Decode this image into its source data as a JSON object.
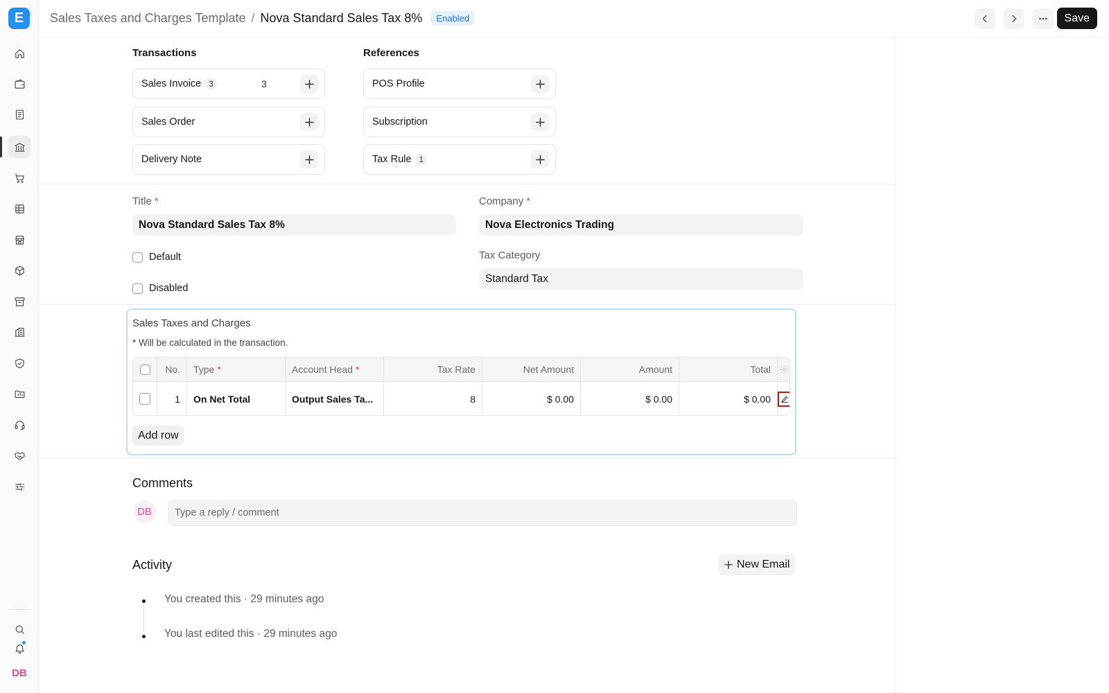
{
  "app": {
    "logo_letter": "E"
  },
  "sidebar": {
    "items": [
      {
        "name": "home-icon"
      },
      {
        "name": "wallet-icon"
      },
      {
        "name": "document-icon"
      },
      {
        "name": "bank-icon"
      },
      {
        "name": "cart-icon"
      },
      {
        "name": "table-icon"
      },
      {
        "name": "store-icon"
      },
      {
        "name": "package-icon"
      },
      {
        "name": "archive-icon"
      },
      {
        "name": "building-icon"
      },
      {
        "name": "shield-icon"
      },
      {
        "name": "folder-icon"
      },
      {
        "name": "headset-icon"
      },
      {
        "name": "handshake-icon"
      },
      {
        "name": "sliders-icon"
      }
    ],
    "active_index": 3,
    "bottom": {
      "search": "search-icon",
      "notifications": "bell-icon",
      "user_initials": "DB"
    }
  },
  "header": {
    "breadcrumb_parent": "Sales Taxes and Charges Template",
    "breadcrumb_separator": "/",
    "title": "Nova Standard Sales Tax 8%",
    "status": "Enabled",
    "save_label": "Save"
  },
  "connections": {
    "transactions_title": "Transactions",
    "references_title": "References",
    "transactions": [
      {
        "label": "Sales Invoice",
        "count": "3",
        "number": "3"
      },
      {
        "label": "Sales Order"
      },
      {
        "label": "Delivery Note"
      }
    ],
    "references": [
      {
        "label": "POS Profile"
      },
      {
        "label": "Subscription"
      },
      {
        "label": "Tax Rule",
        "count": "1"
      }
    ]
  },
  "form": {
    "title_label": "Title",
    "title_value": "Nova Standard Sales Tax 8%",
    "company_label": "Company",
    "company_value": "Nova Electronics Trading",
    "default_label": "Default",
    "disabled_label": "Disabled",
    "tax_category_label": "Tax Category",
    "tax_category_value": "Standard Tax",
    "required_mark": "*"
  },
  "taxes": {
    "title": "Sales Taxes and Charges",
    "description": "* Will be calculated in the transaction.",
    "columns": {
      "no": "No.",
      "type": "Type",
      "account_head": "Account Head",
      "tax_rate": "Tax Rate",
      "net_amount": "Net Amount",
      "amount": "Amount",
      "total": "Total"
    },
    "rows": [
      {
        "no": "1",
        "type": "On Net Total",
        "account_head": "Output Sales Ta...",
        "tax_rate": "8",
        "net_amount": "$ 0.00",
        "amount": "$ 0.00",
        "total": "$ 0.00"
      }
    ],
    "add_row_label": "Add row"
  },
  "comments": {
    "heading": "Comments",
    "avatar_initials": "DB",
    "placeholder": "Type a reply / comment"
  },
  "activity": {
    "heading": "Activity",
    "new_email_label": "New Email",
    "events": [
      {
        "text": "You created this · 29 minutes ago"
      },
      {
        "text": "You last edited this · 29 minutes ago"
      }
    ]
  },
  "colors": {
    "accent": "#2490ef",
    "required": "#e24c4c",
    "status_bg": "#e6f1fd",
    "status_text": "#2375cf",
    "avatar": "#e04e9a",
    "edit_outline": "#b31b1b"
  }
}
